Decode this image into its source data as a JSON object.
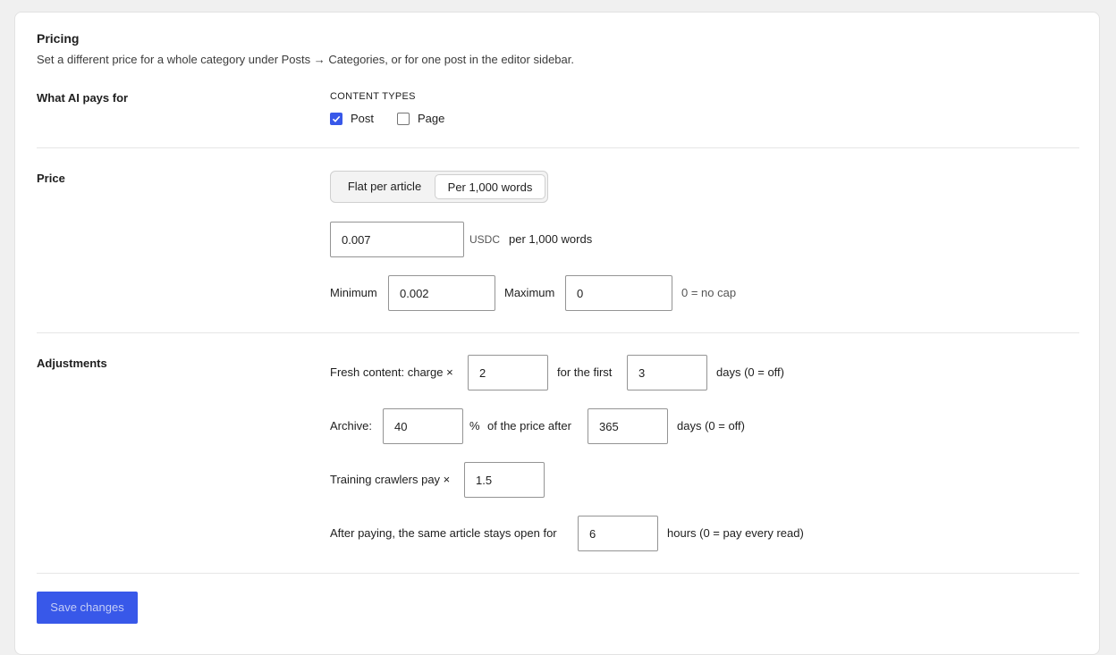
{
  "header": {
    "title": "Pricing",
    "description": "Set a different price for a whole category under Posts → Categories, or for one post in the editor sidebar."
  },
  "what_ai_pays": {
    "label": "What AI pays for",
    "group_caption": "CONTENT TYPES",
    "options": [
      {
        "label": "Post",
        "checked": true
      },
      {
        "label": "Page",
        "checked": false
      }
    ]
  },
  "price": {
    "label": "Price",
    "modes": [
      {
        "label": "Flat per article",
        "active": false
      },
      {
        "label": "Per 1,000 words",
        "active": true
      }
    ],
    "amount": "0.007",
    "currency": "USDC",
    "unit_text": "per 1,000 words",
    "minimum_label": "Minimum",
    "minimum": "0.002",
    "maximum_label": "Maximum",
    "maximum": "0",
    "maximum_hint": "0 = no cap"
  },
  "adjustments": {
    "label": "Adjustments",
    "fresh_prefix": "Fresh content: charge ×",
    "fresh_multiplier": "2",
    "fresh_middle": "for the first",
    "fresh_days": "3",
    "fresh_suffix": "days (0 = off)",
    "archive_prefix": "Archive:",
    "archive_percent": "40",
    "archive_pct_sign": "%",
    "archive_middle": "of the price after",
    "archive_days": "365",
    "archive_suffix": "days (0 = off)",
    "training_prefix": "Training crawlers pay ×",
    "training_multiplier": "1.5",
    "open_prefix": "After paying, the same article stays open for",
    "open_hours": "6",
    "open_suffix": "hours (0 = pay every read)"
  },
  "footer": {
    "save_label": "Save changes"
  },
  "colors": {
    "accent": "#3858e9",
    "background": "#f0f0f0"
  }
}
